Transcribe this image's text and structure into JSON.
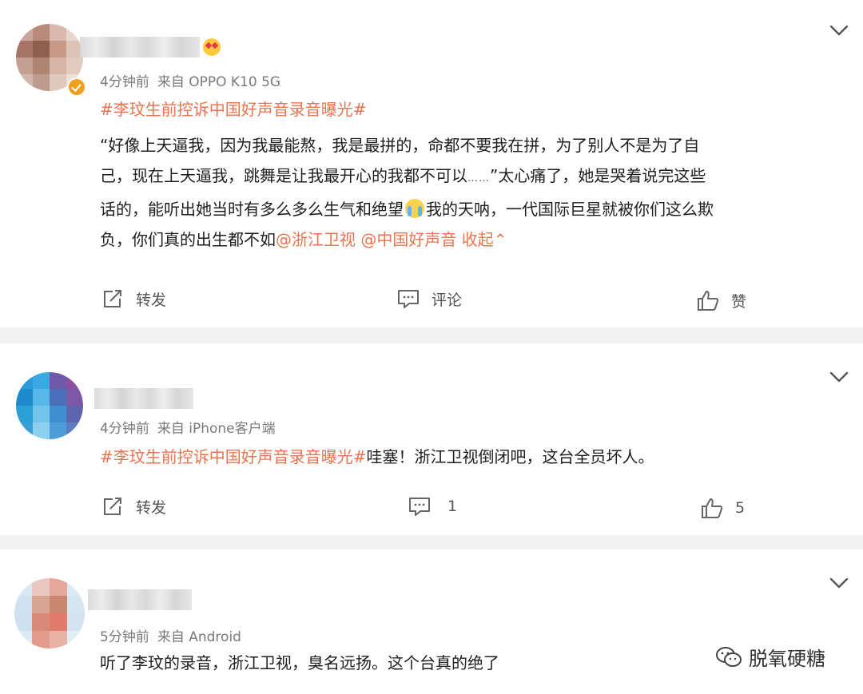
{
  "posts": [
    {
      "time": "4分钟前",
      "source_prefix": "来自",
      "source": "OPPO K10 5G",
      "hashtag": "#李玟生前控诉中国好声音录音曝光#",
      "body": {
        "line1": "“好像上天逼我，因为我最能熬，我是最拼的，命都不要我在拼，为了别人不是为了自",
        "line2_a": "己，现在上天逼我，跳舞是让我最开心的我都不可以",
        "line2_dots": "……",
        "line2_b": "”太心痛了，她是哭着说完这些",
        "line3_a": "话的，能听出她当时有多么多么生气和绝望",
        "line3_b": "我的天呐，一代国际巨星就被你们这么欺",
        "line4": "负，你们真的出生都不如"
      },
      "mention1": "@浙江卫视",
      "mention2": "@中国好声音",
      "collapse": "收起",
      "repost": "转发",
      "comment": "评论",
      "like": "赞"
    },
    {
      "time": "4分钟前",
      "source_prefix": "来自",
      "source": "iPhone客户端",
      "hashtag": "#李玟生前控诉中国好声音录音曝光#",
      "body_text": "哇塞！浙江卫视倒闭吧，这台全员坏人。",
      "repost": "转发",
      "comment": "1",
      "like": "5"
    },
    {
      "time": "5分钟前",
      "source_prefix": "来自",
      "source": "Android",
      "body_text": "听了李玟的录音，浙江卫视，臭名远扬。这个台真的绝了"
    }
  ],
  "watermark": "脱氧硬糖",
  "icons": {
    "repost": "repost-icon",
    "comment": "comment-icon",
    "like": "thumbs-up-icon",
    "menu": "chevron-down-icon",
    "verified": "verified-badge-icon",
    "watermark": "wechat-icon"
  },
  "colors": {
    "accent": "#eb7350",
    "meta": "#7a7a7a",
    "text": "#1e1e1e",
    "separator": "#f2f2f2"
  }
}
